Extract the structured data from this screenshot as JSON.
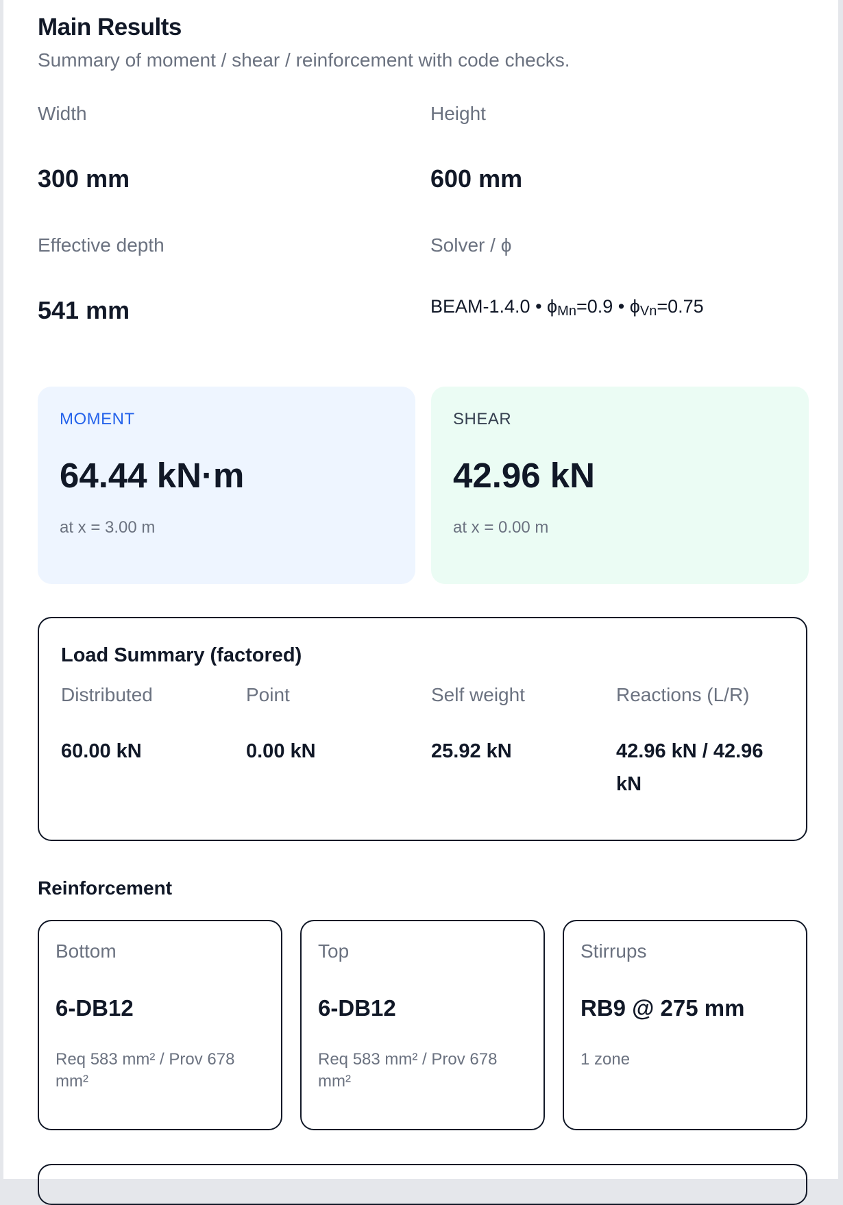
{
  "header": {
    "title": "Main Results",
    "subtitle": "Summary of moment / shear / reinforcement with code checks."
  },
  "section_props": {
    "width_label": "Width",
    "width_value": "300 mm",
    "height_label": "Height",
    "height_value": "600 mm",
    "depth_label": "Effective depth",
    "depth_value": "541 mm",
    "solver_label": "Solver / ϕ",
    "solver_name": "BEAM-1.4.0",
    "phi_mn_symbol": "ϕ",
    "phi_mn_sub": "Mn",
    "phi_mn_value": "=0.9",
    "phi_vn_symbol": "ϕ",
    "phi_vn_sub": "Vn",
    "phi_vn_value": "=0.75",
    "separator": "•"
  },
  "moment": {
    "kicker": "MOMENT",
    "value": "64.44 kN·m",
    "location": "at x = 3.00 m"
  },
  "shear": {
    "kicker": "SHEAR",
    "value": "42.96 kN",
    "location": "at x = 0.00 m"
  },
  "load_summary": {
    "title": "Load Summary (factored)",
    "columns": [
      {
        "label": "Distributed",
        "value": "60.00 kN"
      },
      {
        "label": "Point",
        "value": "0.00 kN"
      },
      {
        "label": "Self weight",
        "value": "25.92 kN"
      },
      {
        "label": "Reactions (L/R)",
        "value": "42.96 kN / 42.96 kN"
      }
    ]
  },
  "reinforcement": {
    "title": "Reinforcement",
    "cards": [
      {
        "label": "Bottom",
        "value": "6-DB12",
        "note": "Req 583 mm² / Prov 678 mm²"
      },
      {
        "label": "Top",
        "value": "6-DB12",
        "note": "Req 583 mm² / Prov 678 mm²"
      },
      {
        "label": "Stirrups",
        "value": "RB9 @ 275 mm",
        "note": "1 zone"
      }
    ]
  }
}
